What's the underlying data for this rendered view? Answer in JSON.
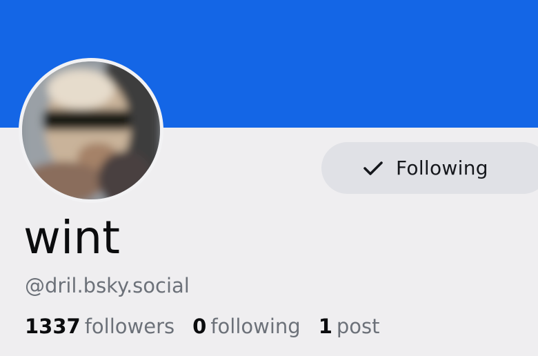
{
  "banner": {
    "color": "#1466e6"
  },
  "avatar": {
    "icon": "profile-photo"
  },
  "follow_button": {
    "icon": "checkmark-icon",
    "label": "Following"
  },
  "profile": {
    "display_name": "wint",
    "handle": "@dril.bsky.social"
  },
  "stats": {
    "followers": {
      "count": "1337",
      "label": "followers"
    },
    "following": {
      "count": "0",
      "label": "following"
    },
    "posts": {
      "count": "1",
      "label": "post"
    }
  }
}
